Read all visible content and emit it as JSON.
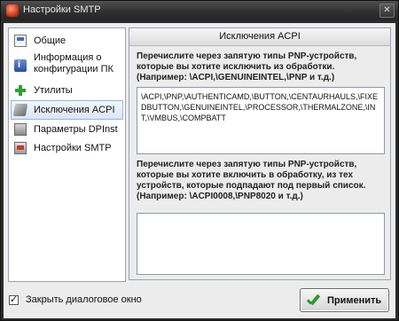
{
  "window": {
    "title": "Настройки SMTP",
    "close_label": "✕"
  },
  "sidebar": {
    "items": [
      {
        "label": "Общие",
        "icon": "general-icon"
      },
      {
        "label": "Информация о конфигурации ПК",
        "icon": "info-icon"
      },
      {
        "label": "Утилиты",
        "icon": "plus-icon"
      },
      {
        "label": "Исключения ACPI",
        "icon": "acpi-icon",
        "selected": true
      },
      {
        "label": "Параметры DPInst",
        "icon": "dpinst-icon"
      },
      {
        "label": "Настройки SMTP",
        "icon": "smtp-icon"
      }
    ]
  },
  "panel": {
    "title": "Исключения ACPI",
    "exclude_description": "Перечислите через запятую типы PNP-устройств, которые вы хотите исключить из обработки. (Например: \\ACPI,\\GENUINEINTEL,\\PNP и т.д.)",
    "exclude_value": "\\ACPI,\\PNP,\\AUTHENTICAMD,\\BUTTON,\\CENTAURHAULS,\\FIXEDBUTTON,\\GENUINEINTEL,\\PROCESSOR,\\THERMALZONE,\\INT,\\VMBUS,\\COMPBATT",
    "include_description": "Перечислите через запятую типы PNP-устройств, которые вы хотите включить в обработку, из тех устройств, которые подпадают под первый список. (Например: \\ACPI0008,\\PNP8020 и т.д.)",
    "include_value": ""
  },
  "footer": {
    "close_dialog_label": "Закрыть диалоговое окно",
    "close_dialog_checked": true,
    "apply_label": "Применить"
  },
  "colors": {
    "titlebar": "#2e2e2e",
    "client_bg": "#ececec",
    "selected_item": "#dbe6f6",
    "apply_check": "#2a9a2a"
  }
}
